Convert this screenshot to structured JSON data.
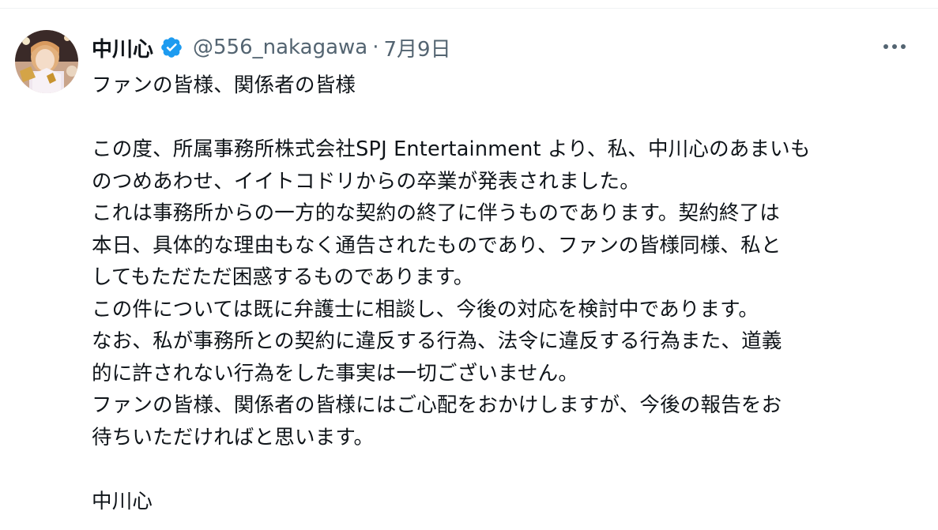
{
  "author": {
    "display_name": "中川心",
    "handle": "@556_nakagawa",
    "separator": "·",
    "date": "7月9日",
    "verified": true
  },
  "colors": {
    "text_primary": "#0f1419",
    "text_secondary": "#536471",
    "verified_blue": "#1d9bf0",
    "divider": "#eff3f4"
  },
  "icons": {
    "verified": "verified-badge-icon",
    "more": "more-horizontal-icon"
  },
  "tweet": {
    "lines": [
      "ファンの皆様、関係者の皆様",
      "",
      "この度、所属事務所株式会社SPJ Entertainment より、私、中川心のあまいも",
      "のつめあわせ、イイトコドリからの卒業が発表されました。",
      "これは事務所からの一方的な契約の終了に伴うものであります。契約終了は",
      "本日、具体的な理由もなく通告されたものであり、ファンの皆様同様、私と",
      "してもただただ困惑するものであります。",
      "この件については既に弁護士に相談し、今後の対応を検討中であります。",
      "なお、私が事務所との契約に違反する行為、法令に違反する行為また、道義",
      "的に許されない行為をした事実は一切ございません。",
      "ファンの皆様、関係者の皆様にはご心配をおかけしますが、今後の報告をお",
      "待ちいただければと思います。",
      "",
      "中川心"
    ]
  }
}
